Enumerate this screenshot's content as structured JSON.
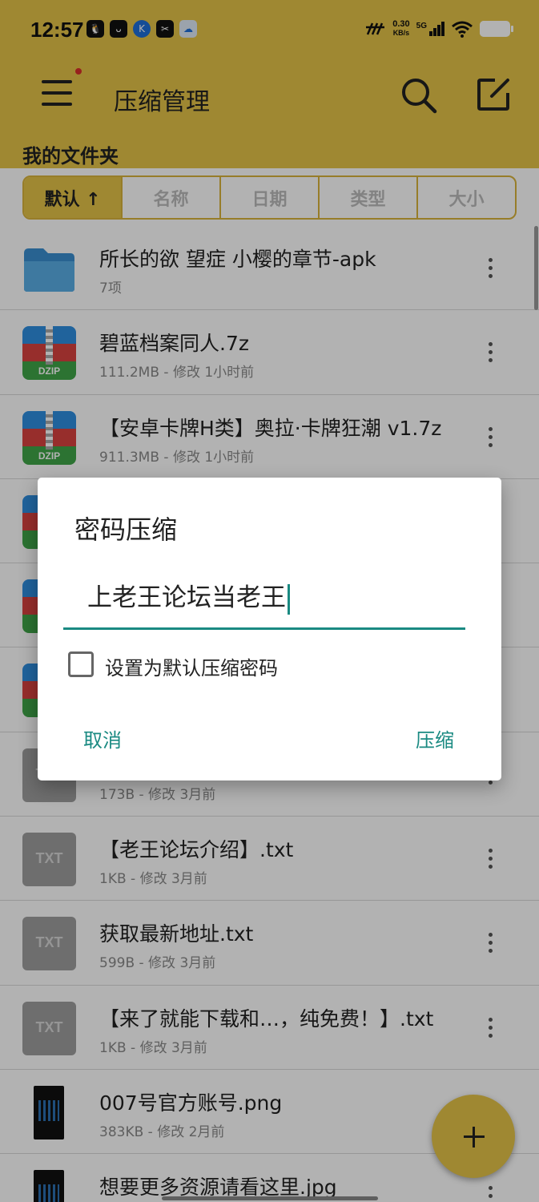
{
  "status_bar": {
    "time": "12:57",
    "app_icons": [
      "qq-icon",
      "soul-icon",
      "k-icon",
      "capcut-icon",
      "cloud-icon"
    ],
    "net_speed_value": "0.30",
    "net_speed_unit": "KB/s",
    "signal_label": "5G",
    "battery_level": 0.75
  },
  "app_bar": {
    "title": "压缩管理",
    "folder_label": "我的文件夹"
  },
  "sort_tabs": [
    {
      "label": "默认 ↑",
      "active": true
    },
    {
      "label": "名称",
      "active": false
    },
    {
      "label": "日期",
      "active": false
    },
    {
      "label": "类型",
      "active": false
    },
    {
      "label": "大小",
      "active": false
    }
  ],
  "files": [
    {
      "name": "所长的欲 望症 小樱的章节-apk",
      "meta": "7项",
      "type": "folder"
    },
    {
      "name": "碧蓝档案同人.7z",
      "meta": "111.2MB - 修改 1小时前",
      "type": "zip"
    },
    {
      "name": "【安卓卡牌H类】奥拉·卡牌狂潮 v1.7z",
      "meta": "911.3MB - 修改 1小时前",
      "type": "zip"
    },
    {
      "name": "",
      "meta": "",
      "type": "zip"
    },
    {
      "name": "",
      "meta": "",
      "type": "zip"
    },
    {
      "name": "",
      "meta": "",
      "type": "zip"
    },
    {
      "name": "",
      "meta": "173B - 修改 3月前",
      "type": "txt"
    },
    {
      "name": "【老王论坛介绍】.txt",
      "meta": "1KB - 修改 3月前",
      "type": "txt"
    },
    {
      "name": "获取最新地址.txt",
      "meta": "599B - 修改 3月前",
      "type": "txt"
    },
    {
      "name": "【来了就能下载和…，纯免费！】.txt",
      "meta": "1KB - 修改 3月前",
      "type": "txt"
    },
    {
      "name": "007号官方账号.png",
      "meta": "383KB - 修改 2月前",
      "type": "image"
    },
    {
      "name": "想要更多资源请看这里.jpg",
      "meta": "",
      "type": "image"
    }
  ],
  "icons": {
    "zip_label": "DZIP",
    "txt_label": "TXT"
  },
  "dialog": {
    "title": "密码压缩",
    "password_value": "上老王论坛当老王",
    "checkbox_label": "设置为默认压缩密码",
    "checkbox_checked": false,
    "cancel_label": "取消",
    "confirm_label": "压缩"
  },
  "colors": {
    "accent": "#e4c348",
    "dialog_accent": "#1a8a82"
  }
}
